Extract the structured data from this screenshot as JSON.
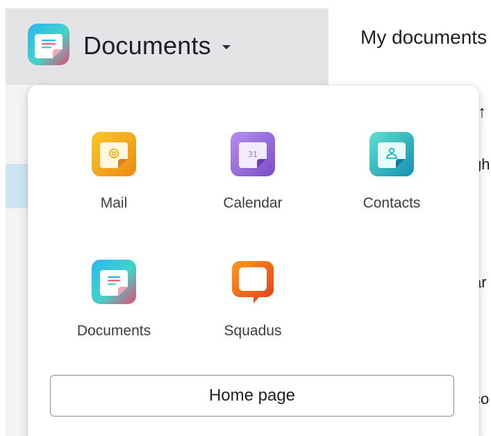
{
  "header": {
    "app_title": "Documents",
    "breadcrumb": "My documents"
  },
  "background": {
    "sort_arrow": "↑",
    "fragments": [
      "gh",
      "-",
      "ar",
      "co"
    ]
  },
  "app_switcher": {
    "apps": [
      {
        "label": "Mail",
        "icon": "mail-icon"
      },
      {
        "label": "Calendar",
        "icon": "calendar-icon",
        "badge": "31"
      },
      {
        "label": "Contacts",
        "icon": "contacts-icon"
      },
      {
        "label": "Documents",
        "icon": "documents-icon"
      },
      {
        "label": "Squadus",
        "icon": "squadus-icon"
      }
    ],
    "home_button_label": "Home page"
  },
  "colors": {
    "header_bg": "#e3e4e6",
    "selected_row": "#cde5f2",
    "mail": "#f1b51a",
    "calendar": "#9a6fd6",
    "contacts": "#1fb0c6",
    "documents_blue": "#27b3e6",
    "documents_pink": "#ef5f8c",
    "squadus": "#f0561a"
  }
}
